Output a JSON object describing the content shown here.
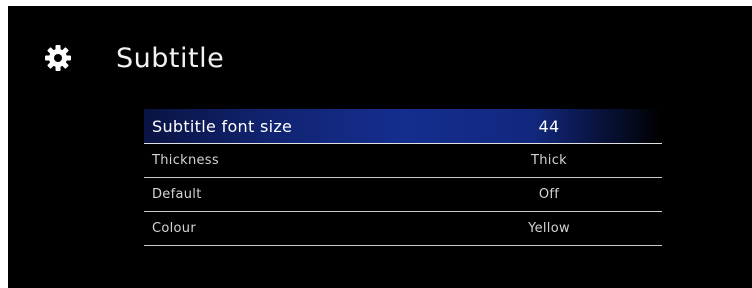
{
  "header": {
    "icon": "gear-icon",
    "title": "Subtitle"
  },
  "settings": [
    {
      "label": "Subtitle font size",
      "value": "44",
      "selected": true
    },
    {
      "label": "Thickness",
      "value": "Thick",
      "selected": false
    },
    {
      "label": "Default",
      "value": "Off",
      "selected": false
    },
    {
      "label": "Colour",
      "value": "Yellow",
      "selected": false
    }
  ],
  "colors": {
    "background": "#000000",
    "highlight": "#163096",
    "text": "#d4d4d4"
  }
}
